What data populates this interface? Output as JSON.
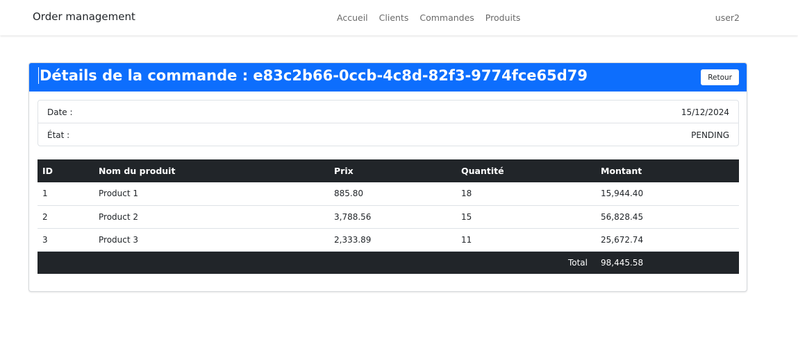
{
  "navbar": {
    "brand": "Order management",
    "links": [
      {
        "label": "Accueil"
      },
      {
        "label": "Clients"
      },
      {
        "label": "Commandes"
      },
      {
        "label": "Produits"
      }
    ],
    "user": "user2"
  },
  "order": {
    "title": "Détails de la commande : e83c2b66-0ccb-4c8d-82f3-9774fce65d79",
    "back_label": "Retour",
    "info": [
      {
        "label": "Date :",
        "value": "15/12/2024"
      },
      {
        "label": "État :",
        "value": "PENDING"
      }
    ],
    "table": {
      "headers": [
        "ID",
        "Nom du produit",
        "Prix",
        "Quantité",
        "Montant"
      ],
      "rows": [
        {
          "id": "1",
          "name": "Product 1",
          "price": "885.80",
          "qty": "18",
          "amount": "15,944.40"
        },
        {
          "id": "2",
          "name": "Product 2",
          "price": "3,788.56",
          "qty": "15",
          "amount": "56,828.45"
        },
        {
          "id": "3",
          "name": "Product 3",
          "price": "2,333.89",
          "qty": "11",
          "amount": "25,672.74"
        }
      ],
      "total_label": "Total",
      "total_value": "98,445.58"
    }
  },
  "colors": {
    "header_primary": "#0d6efd",
    "table_dark": "#212529"
  }
}
